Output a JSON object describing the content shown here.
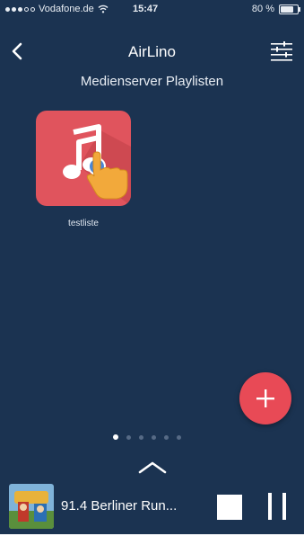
{
  "status_bar": {
    "carrier": "Vodafone.de",
    "time": "15:47",
    "battery": "80 %",
    "battery_level": 0.8
  },
  "nav": {
    "title": "AirLino",
    "back_icon": "chevron-left-icon",
    "settings_icon": "sliders-icon"
  },
  "subtitle": "Medienserver Playlisten",
  "playlists": [
    {
      "label": "testliste",
      "icon": "music-note-icon",
      "color": "#e0545d"
    }
  ],
  "fab": {
    "icon": "plus-icon",
    "color": "#e84a56"
  },
  "pager": {
    "count": 6,
    "active_index": 0
  },
  "player": {
    "station": "91.4 Berliner Run...",
    "stop_icon": "stop-icon",
    "pause_icon": "pause-icon",
    "expand_icon": "chevron-up-icon"
  },
  "colors": {
    "background": "#1b3351",
    "accent": "#e84a56",
    "text": "#ffffff"
  }
}
